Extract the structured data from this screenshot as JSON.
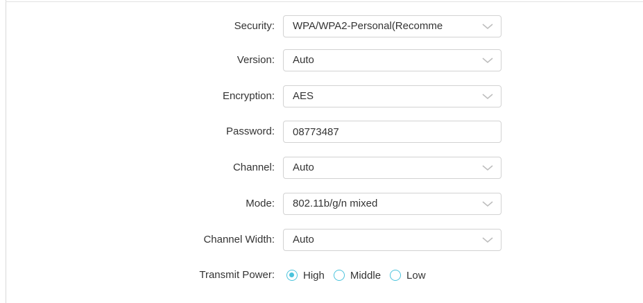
{
  "form": {
    "security": {
      "label": "Security:",
      "value": "WPA/WPA2-Personal(Recomme"
    },
    "version": {
      "label": "Version:",
      "value": "Auto"
    },
    "encryption": {
      "label": "Encryption:",
      "value": "AES"
    },
    "password": {
      "label": "Password:",
      "value": "08773487"
    },
    "channel": {
      "label": "Channel:",
      "value": "Auto"
    },
    "mode": {
      "label": "Mode:",
      "value": "802.11b/g/n mixed"
    },
    "channel_width": {
      "label": "Channel Width:",
      "value": "Auto"
    },
    "transmit_power": {
      "label": "Transmit Power:",
      "options": [
        "High",
        "Middle",
        "Low"
      ],
      "selected": "High"
    }
  },
  "icons": {
    "dropdown": "chevron-down-icon",
    "radio": "radio-circle"
  },
  "colors": {
    "accent": "#4ac3dc",
    "border": "#d2d2d2",
    "text": "#333333"
  }
}
